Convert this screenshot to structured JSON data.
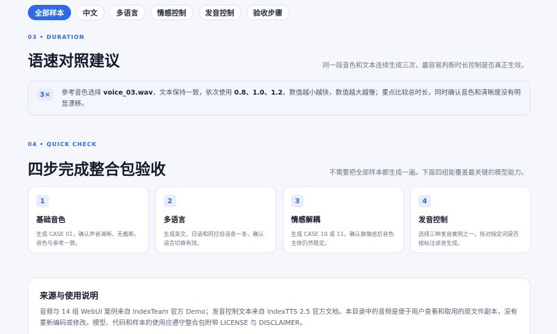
{
  "tabs": [
    {
      "label": "全部样本",
      "active": true
    },
    {
      "label": "中文",
      "active": false
    },
    {
      "label": "多语言",
      "active": false
    },
    {
      "label": "情感控制",
      "active": false
    },
    {
      "label": "发音控制",
      "active": false
    },
    {
      "label": "验收步骤",
      "active": false
    }
  ],
  "section_duration": {
    "eyebrow": "03 • DURATION",
    "title": "语速对照建议",
    "note": "同一段音色和文本连续生成三次，最容易判断时长控制是否真正生效。",
    "tip_badge": "3×",
    "tip_text_1": "参考音色选择 ",
    "tip_file": "voice_03.wav",
    "tip_text_2": "，文本保持一致，依次使用 ",
    "tip_values": "0.8、1.0、1.2",
    "tip_text_3": "。数值越小越快，数值越大越慢；重点比较总时长，同时确认音色和清晰度没有明显漂移。"
  },
  "section_check": {
    "eyebrow": "04 • QUICK CHECK",
    "title": "四步完成整合包验收",
    "note": "不需要把全部样本都生成一遍。下面四组能覆盖最关键的模型能力。",
    "cards": [
      {
        "num": "1",
        "title": "基础音色",
        "desc": "生成 CASE 01，确认声音清晰、无截断、音色与参考一致。"
      },
      {
        "num": "2",
        "title": "多语言",
        "desc": "生成英文、日语和阿拉伯语各一条，确认语言切换有效。"
      },
      {
        "num": "3",
        "title": "情感解耦",
        "desc": "生成 CASE 10 或 11，确认换情感后音色主体仍然稳定。"
      },
      {
        "num": "4",
        "title": "发音控制",
        "desc": "选择三种发音案例之一，核对指定词是否按标注读音生成。"
      }
    ]
  },
  "source": {
    "title": "来源与使用说明",
    "text": "音频与 14 组 WebUI 案例来自 IndexTeam 官方 Demo；发音控制文本来自 IndexTTS 2.5 官方文档。本目录中的音频是便于用户查看和取用的原文件副本，没有重新编码或修改。模型、代码和样本的使用应遵守整合包附带 LICENSE 与 DISCLAIMER。"
  },
  "colors": {
    "accent": "#2f6ae6",
    "background": "#f5f7fc",
    "heading": "#131a2c"
  }
}
